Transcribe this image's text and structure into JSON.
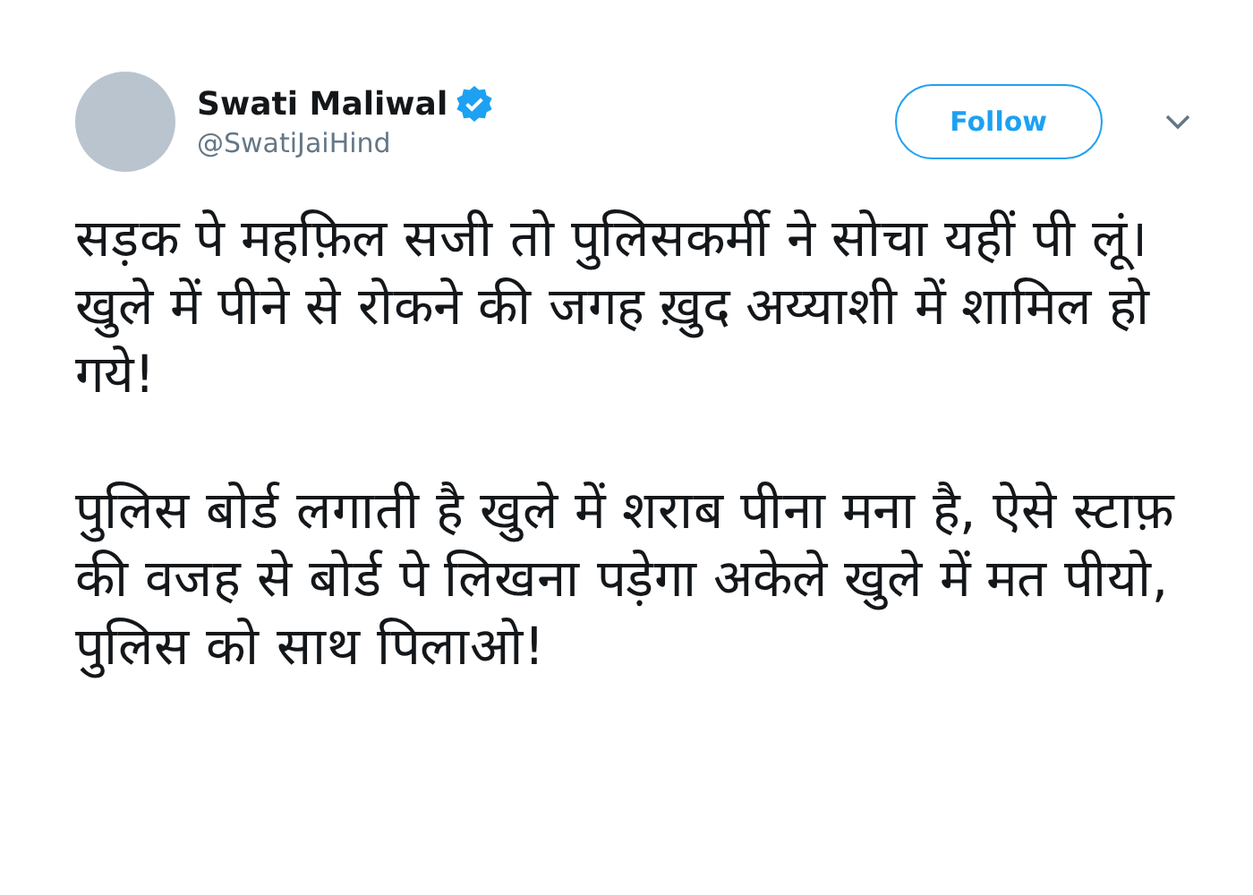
{
  "author": {
    "name": "Swati Maliwal",
    "verified": true,
    "handle": "@SwatiJaiHind"
  },
  "follow_button": {
    "label": "Follow"
  },
  "tweet_text": [
    "सड़क पे महफ़िल सजी तो पुलिसकर्मी ने सोचा यहीं पी लूं। खुले में पीने से रोकने की जगह ख़ुद अय्याशी में शामिल हो गये!",
    "पुलिस बोर्ड लगाती है खुले में शराब पीना मना है, ऐसे स्टाफ़ की वजह से बोर्ड पे लिखना पड़ेगा अकेले खुले में मत पीयो, पुलिस को साथ पिलाओ!"
  ]
}
